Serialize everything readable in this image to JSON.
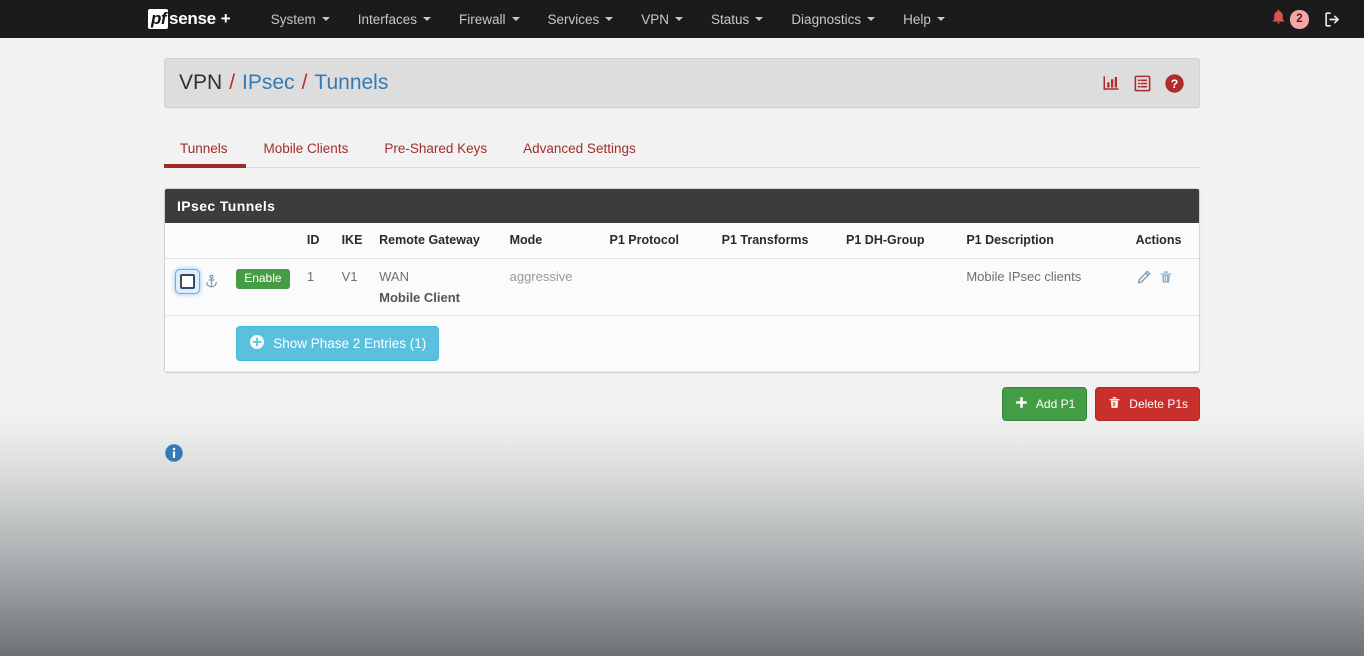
{
  "navbar": {
    "brand": {
      "pf": "pf",
      "sense": "sense",
      "plus": "+"
    },
    "menu": [
      {
        "label": "System"
      },
      {
        "label": "Interfaces"
      },
      {
        "label": "Firewall"
      },
      {
        "label": "Services"
      },
      {
        "label": "VPN"
      },
      {
        "label": "Status"
      },
      {
        "label": "Diagnostics"
      },
      {
        "label": "Help"
      }
    ],
    "notifications": {
      "icon": "bell-icon",
      "count": "2"
    },
    "logout": {
      "icon": "logout-icon"
    }
  },
  "breadcrumb": {
    "root": "VPN",
    "separator": "/",
    "section": "IPsec",
    "page": "Tunnels",
    "icons": [
      "bar-chart-icon",
      "list-icon",
      "help-icon"
    ]
  },
  "tabs": [
    {
      "label": "Tunnels",
      "active": true
    },
    {
      "label": "Mobile Clients",
      "active": false
    },
    {
      "label": "Pre-Shared Keys",
      "active": false
    },
    {
      "label": "Advanced Settings",
      "active": false
    }
  ],
  "panel": {
    "title": "IPsec Tunnels",
    "columns": [
      "",
      "",
      "ID",
      "IKE",
      "Remote Gateway",
      "Mode",
      "P1 Protocol",
      "P1 Transforms",
      "P1 DH-Group",
      "P1 Description",
      "Actions"
    ],
    "rows": [
      {
        "selected": false,
        "status_badge": "Enable",
        "id": "1",
        "ike": "V1",
        "remote_gateway": "WAN",
        "remote_gateway_sub": "Mobile Client",
        "mode": "aggressive",
        "p1_protocol": "",
        "p1_transforms": "",
        "p1_dh_group": "",
        "p1_description": "Mobile IPsec clients",
        "actions": [
          "edit-icon",
          "delete-icon"
        ]
      }
    ],
    "phase2_button": "Show Phase 2 Entries (1)"
  },
  "footer_buttons": {
    "add": "Add P1",
    "delete": "Delete P1s"
  },
  "footer_info_icon": "info-icon",
  "colors": {
    "navbar_bg": "#1b1b1b",
    "accent_red": "#9b2c2a",
    "link_blue": "#337ab7",
    "success_green": "#449d44",
    "danger_red": "#c9302c",
    "info_blue": "#5bc0de",
    "panel_head_bg": "#3c3c3c"
  }
}
